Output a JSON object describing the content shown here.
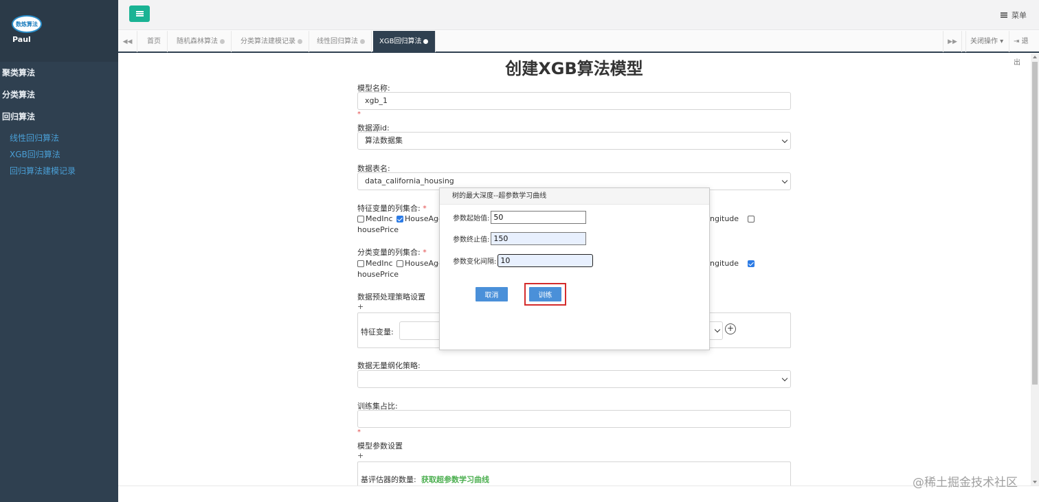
{
  "sidebar": {
    "logo_text": "数炼算法",
    "user": "Paul",
    "menu": [
      "聚类算法",
      "分类算法",
      "回归算法"
    ],
    "sub_items": [
      "线性回归算法",
      "XGB回归算法",
      "回归算法建模记录"
    ]
  },
  "topbar": {
    "menu_label": "菜单"
  },
  "tabs": {
    "items": [
      "首页",
      "随机森林算法",
      "分类算法建模记录",
      "线性回归算法",
      "XGB回归算法"
    ],
    "active": "XGB回归算法",
    "close_ops": "关闭操作",
    "logout": "退出"
  },
  "form": {
    "title": "创建XGB算法模型",
    "model_name_label": "模型名称:",
    "model_name_value": "xgb_1",
    "required_mark": "*",
    "datasource_label": "数据源id:",
    "datasource_value": "算法数据集",
    "table_label": "数据表名:",
    "table_value": "data_california_housing",
    "feature_label": "特征变量的列集合:",
    "feature_checks": [
      {
        "label": "MedInc",
        "checked": false
      },
      {
        "label": "HouseAge",
        "checked": true
      }
    ],
    "feature_tail_label": "ngitude",
    "feature_tail_checked": false,
    "feature_last": "housePrice",
    "class_label": "分类变量的列集合:",
    "class_checks": [
      {
        "label": "MedInc",
        "checked": false
      },
      {
        "label": "HouseAge",
        "checked": false
      }
    ],
    "class_tail_label": "ngitude",
    "class_tail_checked": true,
    "class_last": "housePrice",
    "preprocess_label": "数据预处理策略设置",
    "plus": "+",
    "feature_var_label": "特征变量:",
    "scaling_label": "数据无量纲化策略:",
    "train_ratio_label": "训练集占比:",
    "model_params_label": "模型参数设置",
    "estimator_label": "基评估器的数量:",
    "curve_link": "获取超参数学习曲线"
  },
  "modal": {
    "title": "树的最大深度--超参数学习曲线",
    "start_label": "参数起始值:",
    "start_value": "50",
    "end_label": "参数终止值:",
    "end_value": "150",
    "step_label": "参数变化间隔:",
    "step_value": "10",
    "cancel": "取消",
    "train": "训练"
  },
  "watermark": "@稀土掘金技术社区"
}
